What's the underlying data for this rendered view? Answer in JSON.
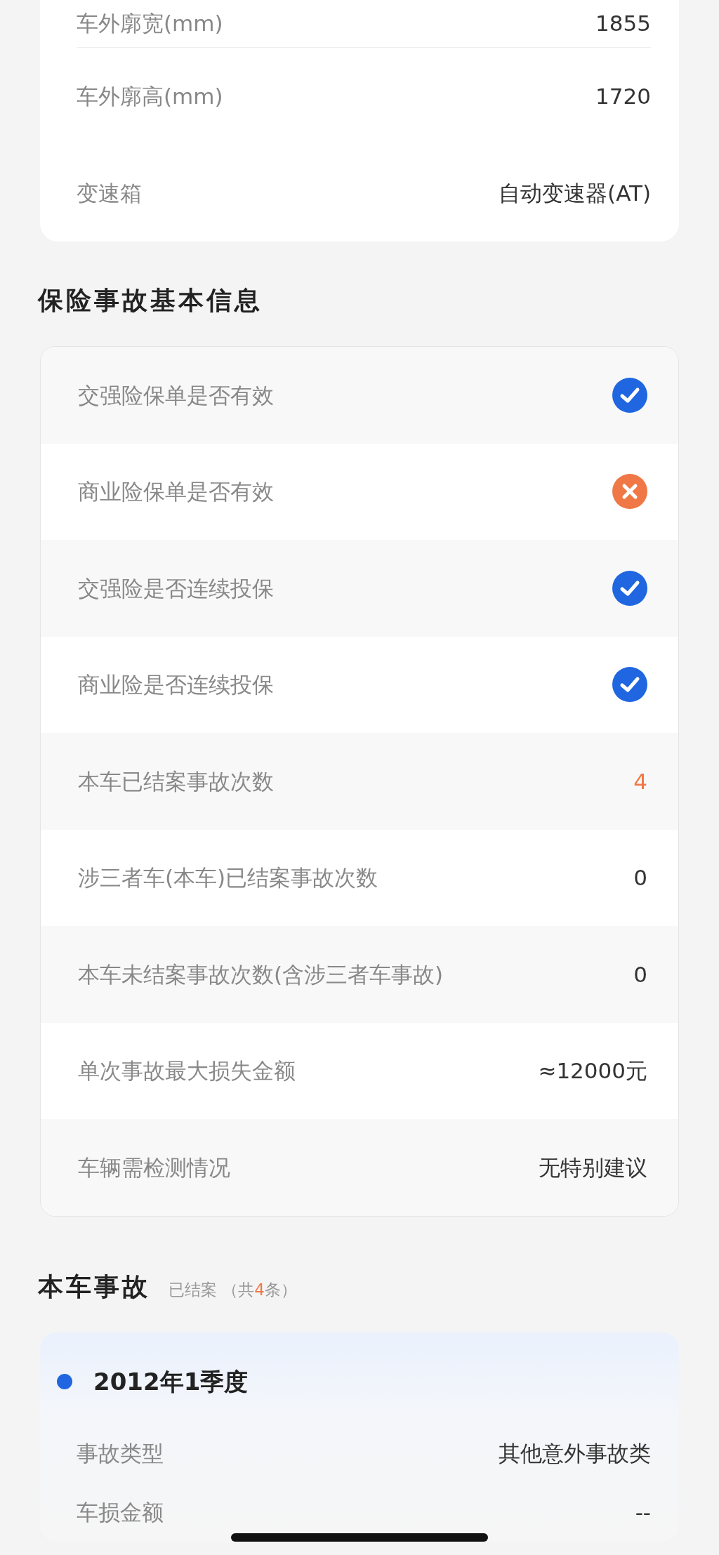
{
  "spec_rows": [
    {
      "label": "车外廓宽(mm)",
      "value": "1855"
    },
    {
      "label": "车外廓高(mm)",
      "value": "1720"
    },
    {
      "label": "变速箱",
      "value": "自动变速器(AT)"
    }
  ],
  "insurance": {
    "title": "保险事故基本信息",
    "rows": [
      {
        "label": "交强险保单是否有效",
        "kind": "check",
        "checked": true
      },
      {
        "label": "商业险保单是否有效",
        "kind": "check",
        "checked": false
      },
      {
        "label": "交强险是否连续投保",
        "kind": "check",
        "checked": true
      },
      {
        "label": "商业险是否连续投保",
        "kind": "check",
        "checked": true
      },
      {
        "label": "本车已结案事故次数",
        "kind": "text",
        "value": "4",
        "alert": true
      },
      {
        "label": "涉三者车(本车)已结案事故次数",
        "kind": "text",
        "value": "0",
        "alert": false
      },
      {
        "label": "本车未结案事故次数(含涉三者车事故)",
        "kind": "text",
        "value": "0",
        "alert": false
      },
      {
        "label": "单次事故最大损失金额",
        "kind": "text",
        "value": "≈12000元",
        "alert": false
      },
      {
        "label": "车辆需检测情况",
        "kind": "text",
        "value": "无特别建议",
        "alert": false
      }
    ]
  },
  "accidents": {
    "title": "本车事故",
    "status": "已结案",
    "total_before": "（共",
    "total": "4",
    "total_after": "条）",
    "items": [
      {
        "period": "2012年1季度",
        "rows": [
          {
            "label": "事故类型",
            "value": "其他意外事故类"
          },
          {
            "label": "车损金额",
            "value": "--"
          }
        ]
      }
    ]
  }
}
